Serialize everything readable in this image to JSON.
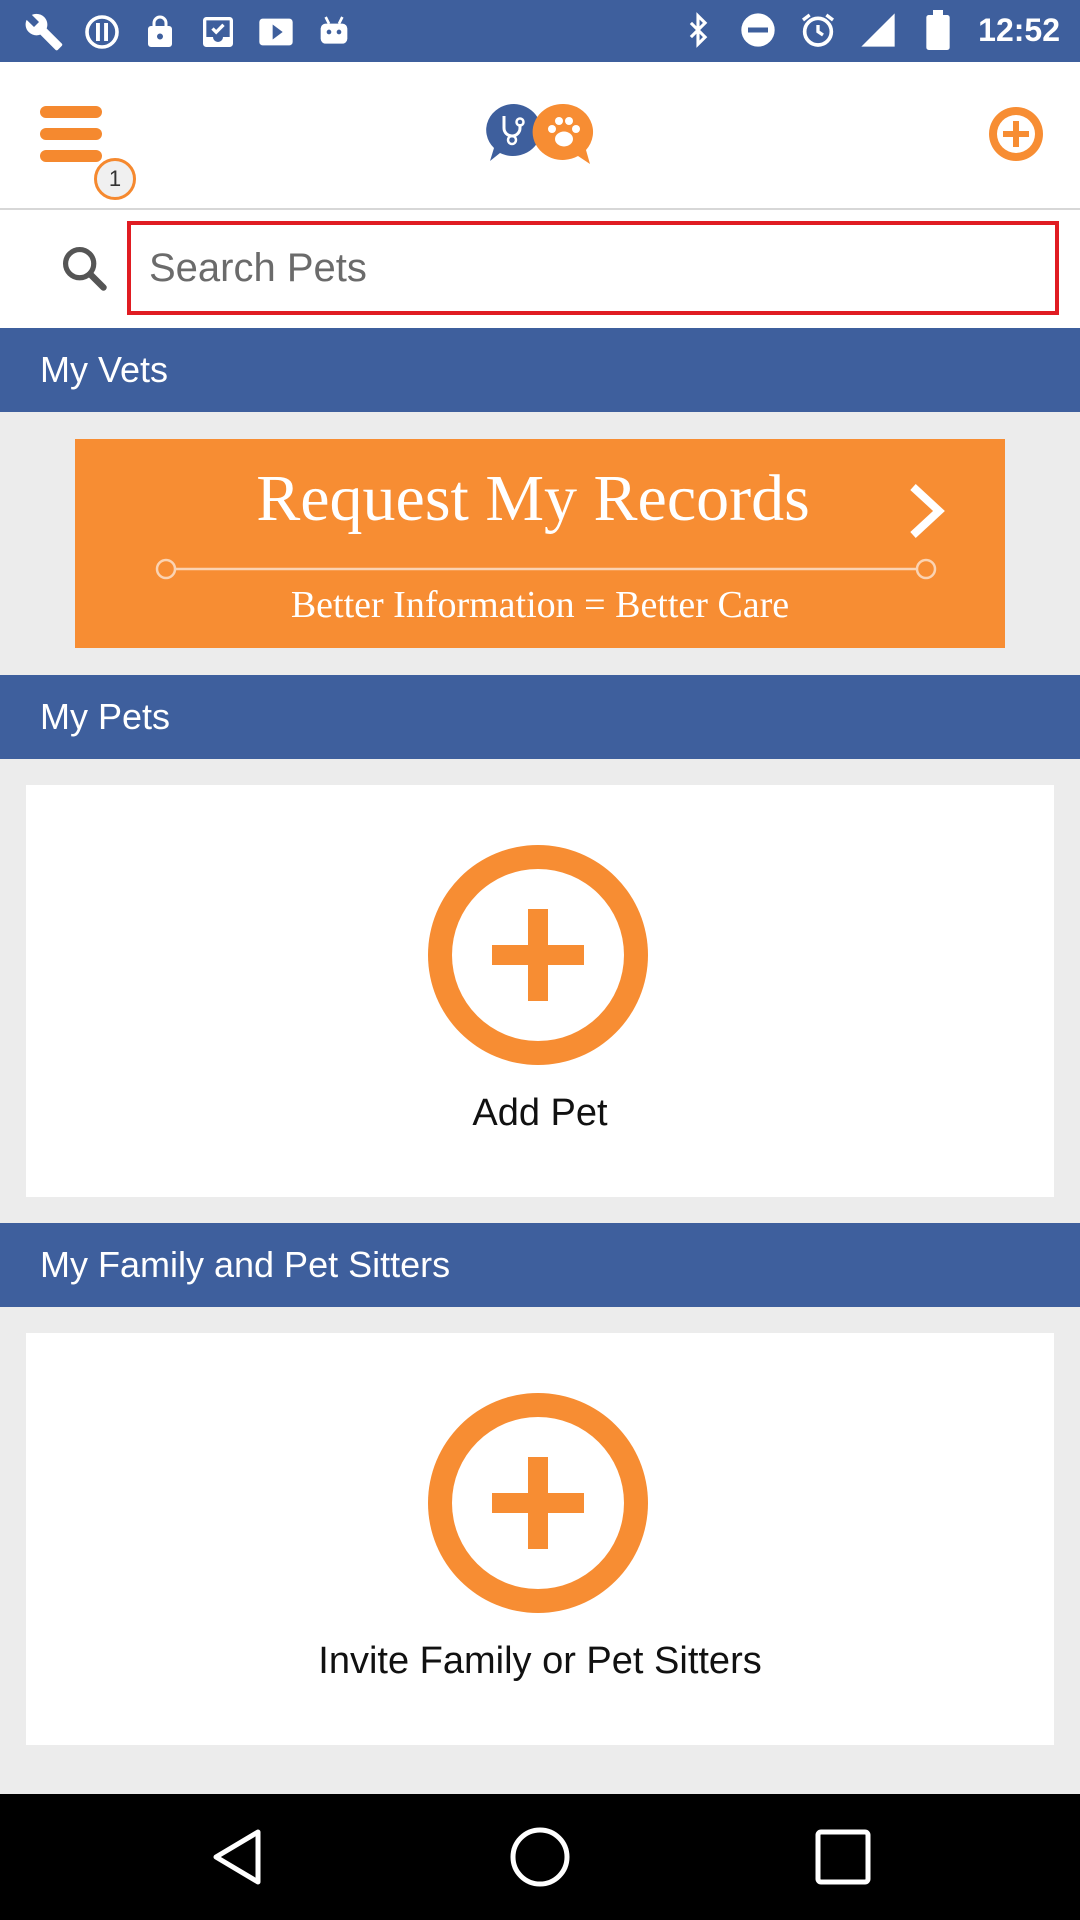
{
  "status_bar": {
    "time": "12:52",
    "left_icons": [
      "wrench-icon",
      "circle-notification-icon",
      "lock-icon",
      "inbox-check-icon",
      "play-icon",
      "android-icon"
    ],
    "right_icons": [
      "bluetooth-icon",
      "do-not-disturb-icon",
      "alarm-icon",
      "signal-icon",
      "battery-icon"
    ]
  },
  "app_bar": {
    "menu_badge": "1",
    "logo_icon": "vet-pet-logo-icon",
    "add_icon": "plus-circle-icon"
  },
  "search": {
    "placeholder": "Search Pets",
    "value": ""
  },
  "sections": {
    "vets": {
      "title": "My Vets",
      "banner_title": "Request My Records",
      "banner_subtitle": "Better Information = Better Care"
    },
    "pets": {
      "title": "My Pets",
      "action_label": "Add Pet"
    },
    "family": {
      "title": "My Family and Pet Sitters",
      "action_label": "Invite Family or Pet Sitters"
    }
  },
  "nav_bar": {
    "buttons": [
      "back-icon",
      "home-icon",
      "recents-icon"
    ]
  },
  "colors": {
    "brand_blue": "#3e5f9d",
    "accent_orange": "#f78d33",
    "search_border": "#e01c22"
  }
}
